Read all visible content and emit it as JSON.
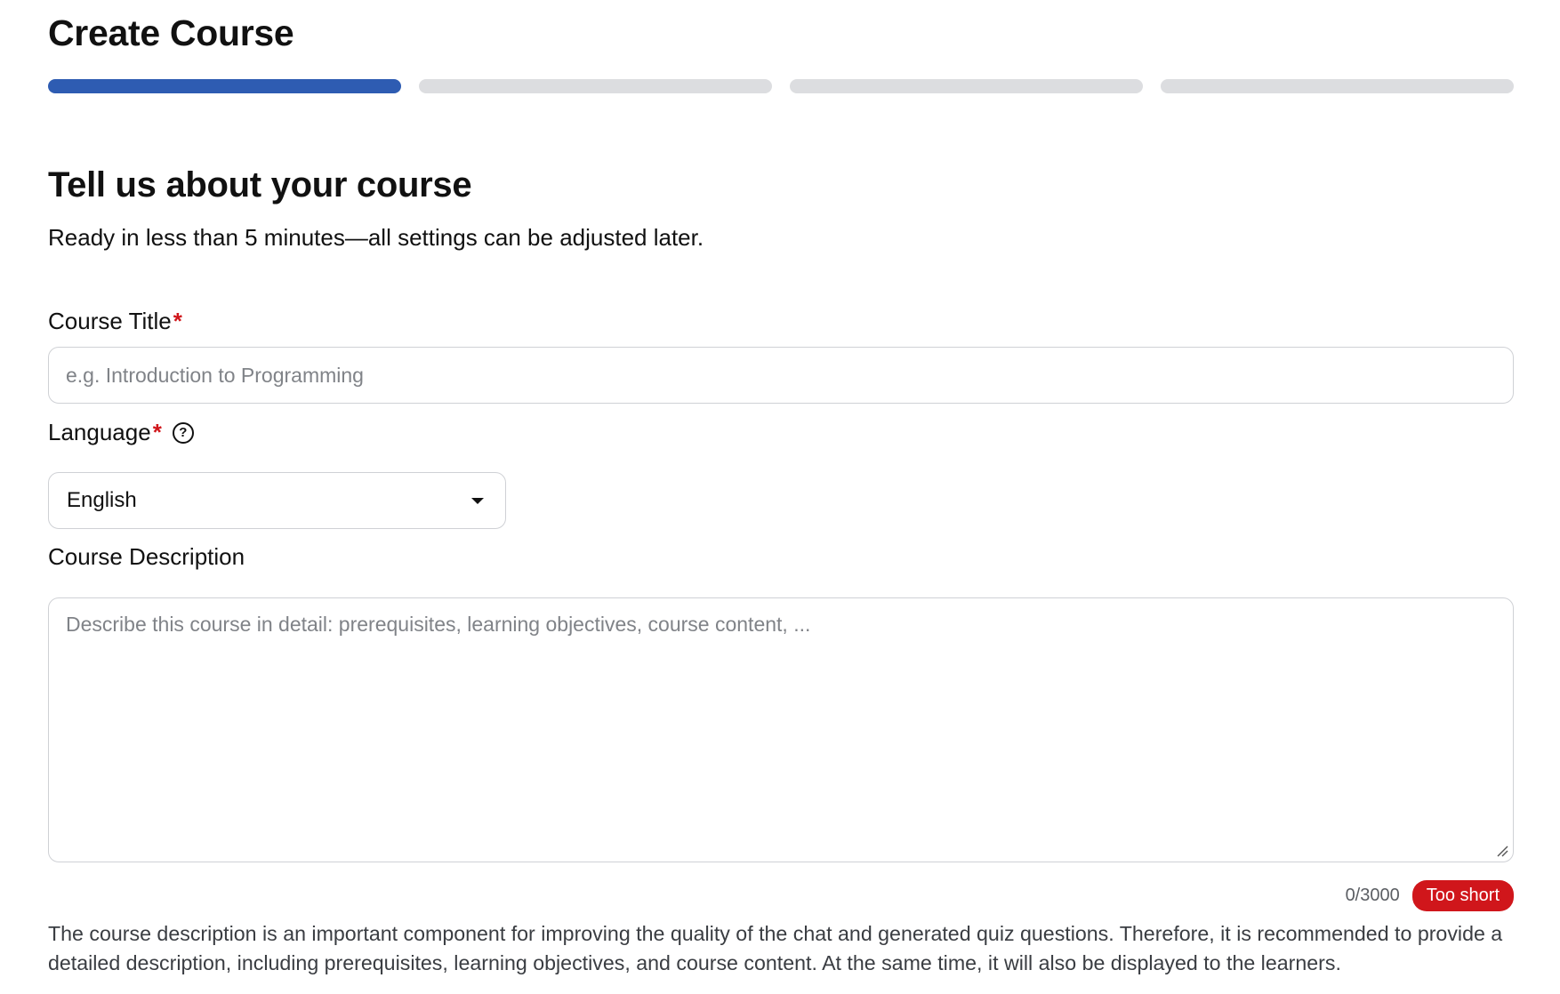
{
  "header": {
    "title": "Create Course"
  },
  "stepper": {
    "total_steps": 4,
    "current_step": 1
  },
  "section": {
    "title": "Tell us about your course",
    "subtitle": "Ready in less than 5 minutes—all settings can be adjusted later."
  },
  "fields": {
    "course_title": {
      "label": "Course Title",
      "required_mark": "*",
      "value": "",
      "placeholder": "e.g. Introduction to Programming"
    },
    "language": {
      "label": "Language",
      "required_mark": "*",
      "help_icon": "question-circle-icon",
      "help_glyph": "?",
      "selected": "English"
    },
    "course_description": {
      "label": "Course Description",
      "value": "",
      "placeholder": "Describe this course in detail: prerequisites, learning objectives, course content, ...",
      "counter": "0/3000",
      "status_badge": "Too short",
      "helper_text": "The course description is an important component for improving the quality of the chat and generated quiz questions. Therefore, it is recommended to provide a detailed description, including prerequisites, learning objectives, and course content. At the same time, it will also be displayed to the learners."
    }
  },
  "colors": {
    "accent": "#2e5cb2",
    "step_inactive": "#dcdde0",
    "required": "#d0161b",
    "badge_bg": "#d0161b",
    "border": "#cfd1d5",
    "placeholder": "#808388"
  }
}
